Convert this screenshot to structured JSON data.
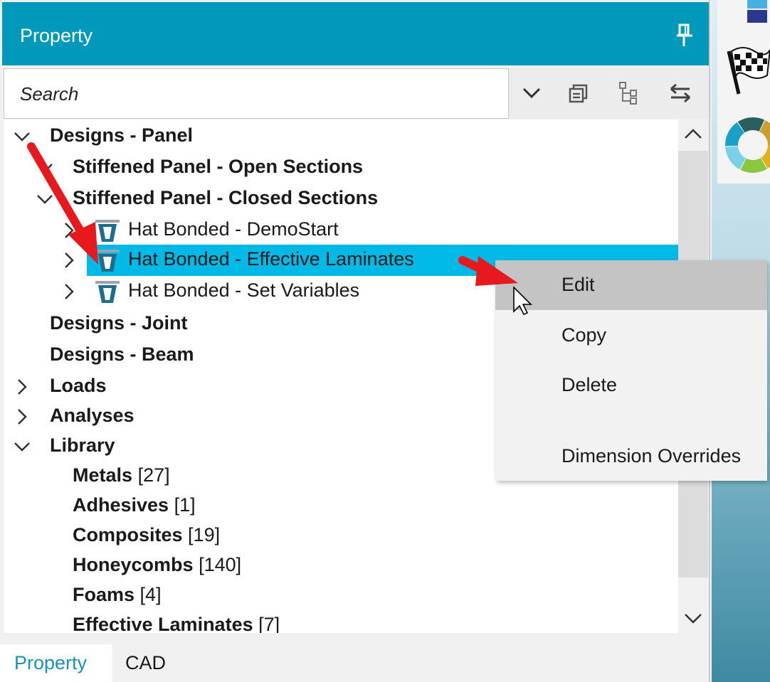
{
  "panel": {
    "title": "Property",
    "search_placeholder": "Search"
  },
  "toolbar": {
    "icons": [
      "chevron-down-icon",
      "collapse-all-icon",
      "tree-view-icon",
      "swap-arrows-icon"
    ]
  },
  "tree": {
    "rows": [
      {
        "label": "Designs - Panel",
        "expanded": true
      },
      {
        "label": "Stiffened Panel - Open Sections",
        "expanded": true
      },
      {
        "label": "Stiffened Panel - Closed Sections",
        "expanded": true
      },
      {
        "label": "Hat Bonded - DemoStart"
      },
      {
        "label": "Hat Bonded - Effective Laminates",
        "selected": true
      },
      {
        "label": "Hat Bonded - Set Variables"
      },
      {
        "label": "Designs - Joint"
      },
      {
        "label": "Designs - Beam"
      },
      {
        "label": "Loads",
        "expanded": false
      },
      {
        "label": "Analyses",
        "expanded": false
      },
      {
        "label": "Library",
        "expanded": true
      },
      {
        "label": "Metals",
        "count": "[27]"
      },
      {
        "label": "Adhesives",
        "count": "[1]"
      },
      {
        "label": "Composites",
        "count": "[19]"
      },
      {
        "label": "Honeycombs",
        "count": "[140]"
      },
      {
        "label": "Foams",
        "count": "[4]"
      },
      {
        "label": "Effective Laminates",
        "count": "[7]"
      }
    ]
  },
  "context_menu": {
    "items": [
      "Edit",
      "Copy",
      "Delete",
      "Dimension Overrides"
    ],
    "hovered": "Edit"
  },
  "tabs": [
    "Property",
    "CAD"
  ],
  "colors": {
    "accent": "#0099bb",
    "selection": "#00b9e6",
    "annotation_arrow": "#e8191c",
    "active_tab_text": "#1b8fb7"
  }
}
